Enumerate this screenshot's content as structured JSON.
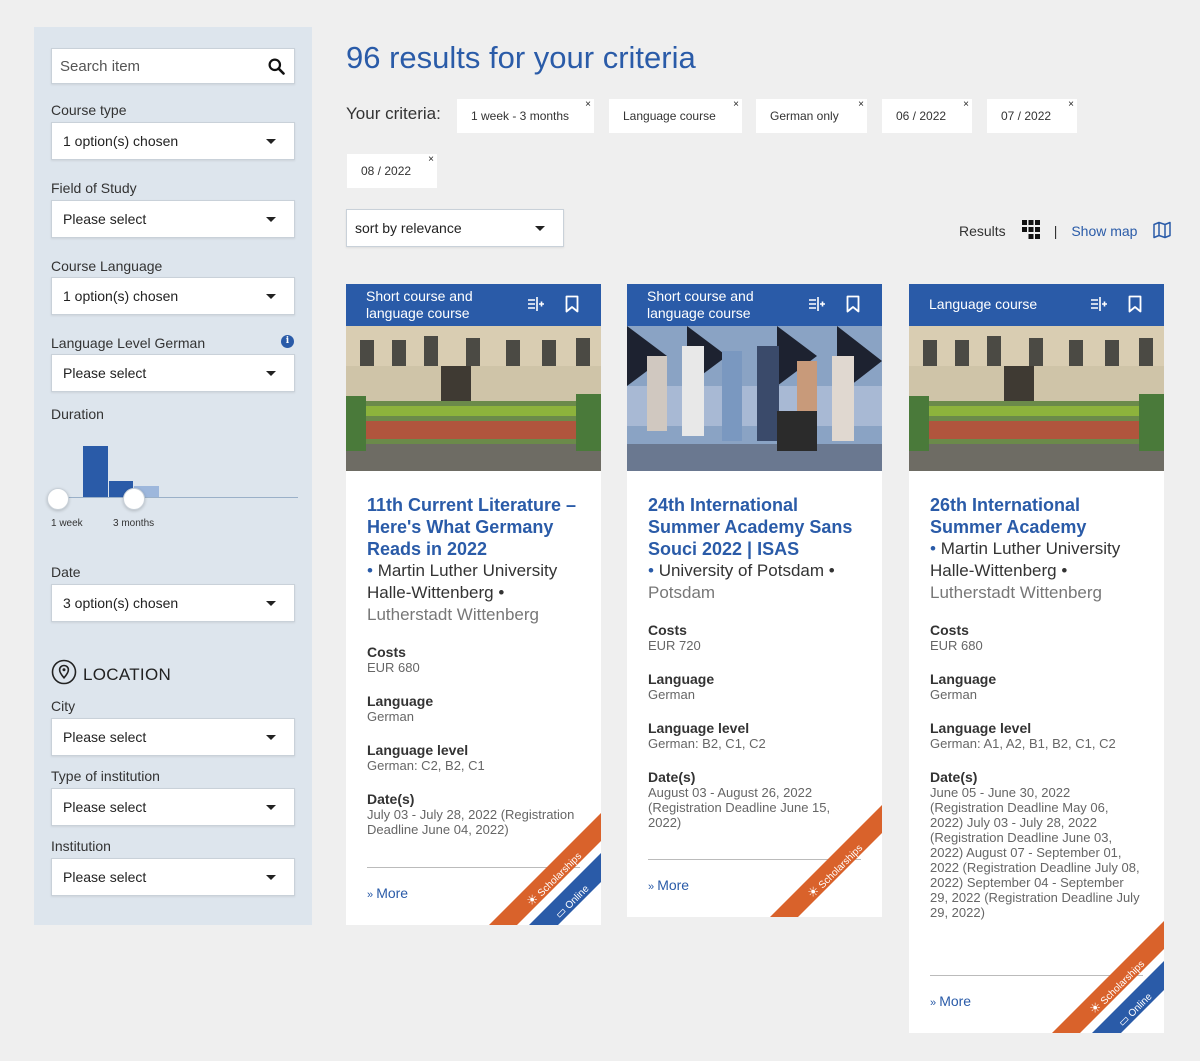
{
  "sidebar": {
    "search_placeholder": "Search item",
    "course_type": {
      "label": "Course type",
      "value": "1 option(s) chosen"
    },
    "field_of_study": {
      "label": "Field of Study",
      "value": "Please select"
    },
    "course_language": {
      "label": "Course Language",
      "value": "1 option(s) chosen"
    },
    "language_level": {
      "label": "Language Level German",
      "value": "Please select",
      "info_icon": "i"
    },
    "duration": {
      "label": "Duration",
      "min_label": "1 week",
      "max_label": "3 months"
    },
    "date": {
      "label": "Date",
      "value": "3 option(s) chosen"
    },
    "location_heading": "LOCATION",
    "city": {
      "label": "City",
      "value": "Please select"
    },
    "institution_type": {
      "label": "Type of institution",
      "value": "Please select"
    },
    "institution": {
      "label": "Institution",
      "value": "Please select"
    }
  },
  "main": {
    "title": "96 results for your criteria",
    "criteria_label": "Your criteria:",
    "chips": [
      "1 week - 3 months",
      "Language course",
      "German only",
      "06 / 2022",
      "07 / 2022",
      "08 / 2022"
    ],
    "chip_close": "×",
    "sort_value": "sort by relevance",
    "results_label": "Results",
    "separator": "|",
    "show_map": "Show map"
  },
  "cards": [
    {
      "type_line1": "Short course and",
      "type_line2": "language course",
      "title": "11th Current Literature – Here's What Germany Reads in 2022",
      "institution": "Martin Luther University Halle-Wittenberg",
      "city": "Lutherstadt Wittenberg",
      "costs_label": "Costs",
      "costs": "EUR 680",
      "language_label": "Language",
      "language": "German",
      "level_label": "Language level",
      "level": "German: C2, B2, C1",
      "dates_label": "Date(s)",
      "dates": "July 03 - July 28, 2022 (Registration Deadline June 04, 2022)",
      "more": "More",
      "ribbon_scholarships": "Scholarships",
      "ribbon_online": "Online"
    },
    {
      "type_line1": "Short course and",
      "type_line2": "language course",
      "title": "24th International Summer Academy Sans Souci 2022 | ISAS",
      "institution": "University of Potsdam",
      "city": "Potsdam",
      "costs_label": "Costs",
      "costs": "EUR 720",
      "language_label": "Language",
      "language": "German",
      "level_label": "Language level",
      "level": "German: B2, C1, C2",
      "dates_label": "Date(s)",
      "dates": "August 03 - August 26, 2022 (Registration Deadline June 15, 2022)",
      "more": "More",
      "ribbon_scholarships": "Scholarships"
    },
    {
      "type_line1": "Language course",
      "title": "26th International Summer Academy",
      "institution": "Martin Luther University Halle-Wittenberg",
      "city": "Lutherstadt Wittenberg",
      "costs_label": "Costs",
      "costs": "EUR 680",
      "language_label": "Language",
      "language": "German",
      "level_label": "Language level",
      "level": "German: A1, A2, B1, B2, C1, C2",
      "dates_label": "Date(s)",
      "dates": "June 05 - June 30, 2022 (Registration Deadline May 06, 2022) July 03 - July 28, 2022 (Registration Deadline June 03, 2022) August 07 - September 01, 2022 (Registration Deadline July 08, 2022) September 04 - September 29, 2022 (Registration Deadline July 29, 2022)",
      "more": "More",
      "ribbon_scholarships": "Scholarships",
      "ribbon_online": "Online"
    }
  ],
  "colors": {
    "accent": "#2a5ba8",
    "ribbon_orange": "#d9622b",
    "ribbon_blue": "#2a5ba8",
    "sidebar_bg": "#dde5ed"
  }
}
